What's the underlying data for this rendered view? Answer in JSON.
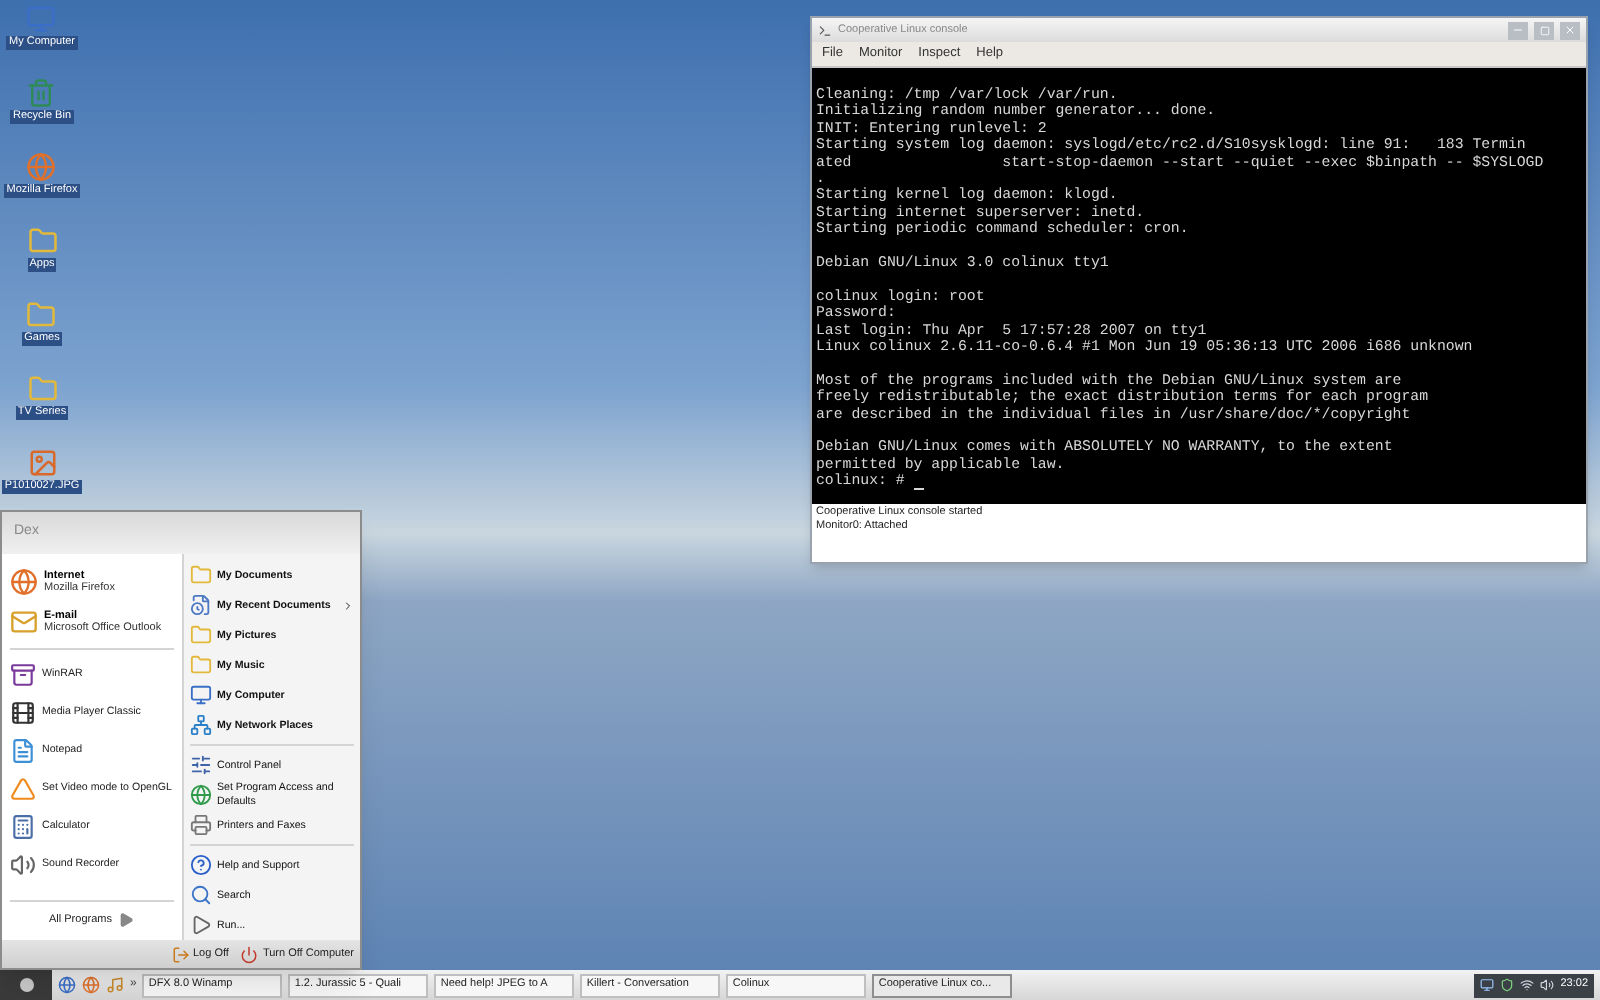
{
  "desktop_icons": [
    {
      "label": "My Computer",
      "kind": "computer"
    },
    {
      "label": "Recycle Bin",
      "kind": "bin"
    },
    {
      "label": "Mozilla Firefox",
      "kind": "browser"
    },
    {
      "label": "Apps",
      "kind": "folder"
    },
    {
      "label": "Games",
      "kind": "folder"
    },
    {
      "label": "TV Series",
      "kind": "folder"
    },
    {
      "label": "P1010027.JPG",
      "kind": "image"
    }
  ],
  "console": {
    "title": "Cooperative Linux console",
    "menu": [
      "File",
      "Monitor",
      "Inspect",
      "Help"
    ],
    "blocks": [
      [
        "Cleaning: /tmp /var/lock /var/run.",
        "Initializing random number generator... done.",
        "INIT: Entering runlevel: 2",
        "Starting system log daemon: syslogd/etc/rc2.d/S10sysklogd: line 91:   183 Termin",
        "ated                 start-stop-daemon --start --quiet --exec $binpath -- $SYSLOGD",
        ".",
        "Starting kernel log daemon: klogd.",
        "Starting internet superserver: inetd.",
        "Starting periodic command scheduler: cron."
      ],
      [
        "Debian GNU/Linux 3.0 colinux tty1"
      ],
      [
        "colinux login: root",
        "Password:",
        "Last login: Thu Apr  5 17:57:28 2007 on tty1",
        "Linux colinux 2.6.11-co-0.6.4 #1 Mon Jun 19 05:36:13 UTC 2006 i686 unknown"
      ],
      [
        "Most of the programs included with the Debian GNU/Linux system are",
        "freely redistributable; the exact distribution terms for each program",
        "are described in the individual files in /usr/share/doc/*/copyright"
      ],
      [
        "Debian GNU/Linux comes with ABSOLUTELY NO WARRANTY, to the extent",
        "permitted by applicable law.",
        "colinux: #"
      ]
    ],
    "status_lines": [
      "Cooperative Linux console started",
      "Monitor0: Attached"
    ]
  },
  "start_menu": {
    "user": "Dex",
    "pinned": [
      {
        "title": "Internet",
        "subtitle": "Mozilla Firefox",
        "kind": "browser"
      },
      {
        "title": "E-mail",
        "subtitle": "Microsoft Office Outlook",
        "kind": "mail"
      }
    ],
    "recent": [
      {
        "label": "WinRAR",
        "kind": "archive"
      },
      {
        "label": "Media Player Classic",
        "kind": "film"
      },
      {
        "label": "Notepad",
        "kind": "notepad"
      },
      {
        "label": "Set Video mode to OpenGL",
        "kind": "cone"
      },
      {
        "label": "Calculator",
        "kind": "calculator"
      },
      {
        "label": "Sound Recorder",
        "kind": "speaker"
      }
    ],
    "all_programs": "All Programs",
    "place_groups": [
      {
        "items": [
          {
            "label": "My Documents",
            "bold": true,
            "submenu": false,
            "kind": "folder"
          },
          {
            "label": "My Recent Documents",
            "bold": true,
            "submenu": true,
            "kind": "document"
          },
          {
            "label": "My Pictures",
            "bold": true,
            "submenu": false,
            "kind": "folder"
          },
          {
            "label": "My Music",
            "bold": true,
            "submenu": false,
            "kind": "folder"
          },
          {
            "label": "My Computer",
            "bold": true,
            "submenu": false,
            "kind": "computer"
          },
          {
            "label": "My Network Places",
            "bold": true,
            "submenu": false,
            "kind": "network"
          }
        ]
      },
      {
        "items": [
          {
            "label": "Control Panel",
            "bold": false,
            "submenu": false,
            "kind": "panel"
          },
          {
            "label": "Set Program Access and Defaults",
            "bold": false,
            "submenu": false,
            "kind": "globe"
          },
          {
            "label": "Printers and Faxes",
            "bold": false,
            "submenu": false,
            "kind": "printer"
          }
        ]
      },
      {
        "items": [
          {
            "label": "Help and Support",
            "bold": false,
            "submenu": false,
            "kind": "help"
          },
          {
            "label": "Search",
            "bold": false,
            "submenu": false,
            "kind": "search"
          },
          {
            "label": "Run...",
            "bold": false,
            "submenu": false,
            "kind": "run"
          }
        ]
      }
    ],
    "footer_buttons": [
      {
        "label": "Log Off",
        "kind": "logoff"
      },
      {
        "label": "Turn Off Computer",
        "kind": "power"
      }
    ]
  },
  "taskbar": {
    "more": "»",
    "tasks": [
      {
        "label": "DFX 8.0 Winamp",
        "selected": false
      },
      {
        "label": "1.2. Jurassic 5 - Quali",
        "selected": false
      },
      {
        "label": "Need help! JPEG to A",
        "selected": false
      },
      {
        "label": "Killert - Conversation",
        "selected": false
      },
      {
        "label": "Colinux",
        "selected": false
      },
      {
        "label": "Cooperative Linux co...",
        "selected": true
      }
    ],
    "clock": "23:02"
  }
}
